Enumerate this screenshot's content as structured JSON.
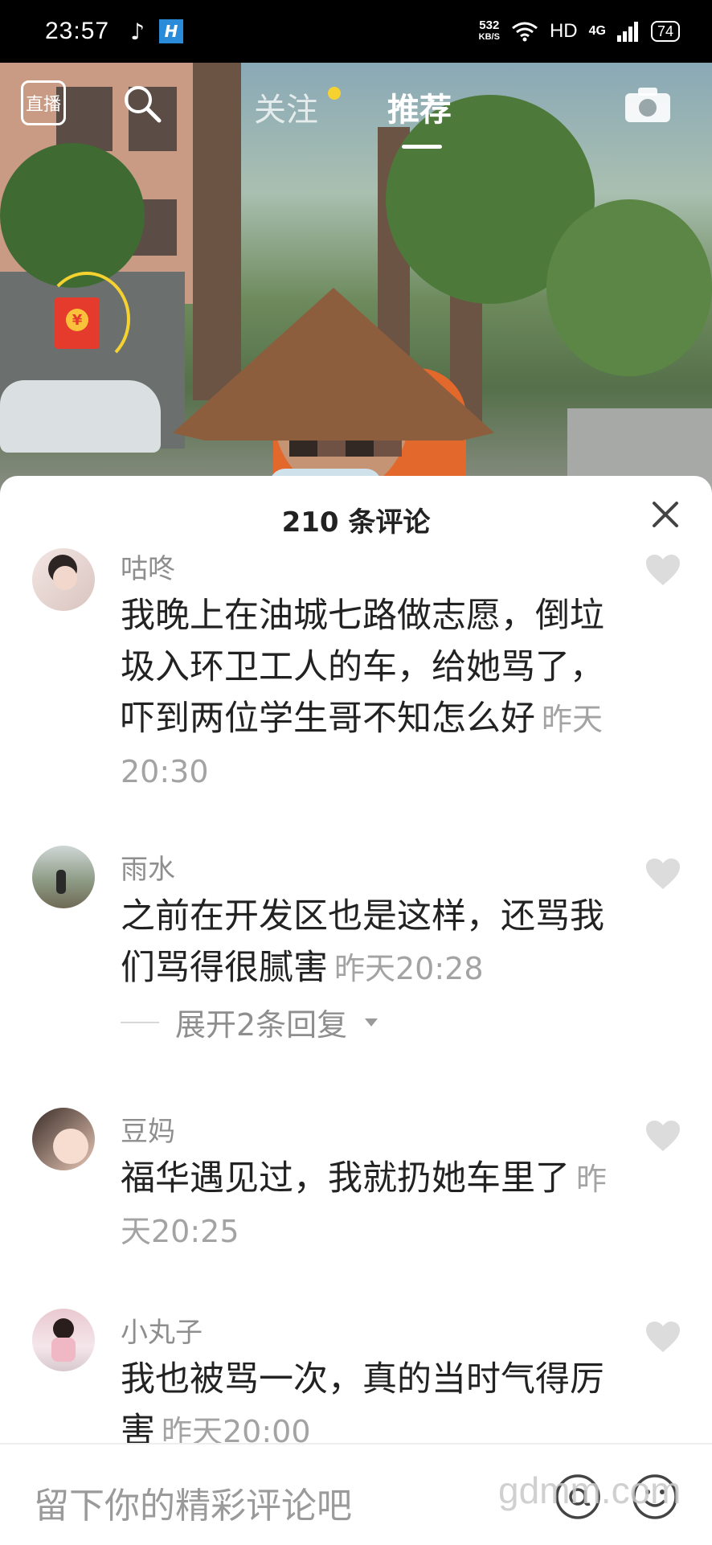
{
  "status_bar": {
    "time": "23:57",
    "app_icon_1": "tiktok-icon",
    "app_icon_2": "app-icon",
    "speed_value": "532",
    "speed_unit": "KB/S",
    "hd": "HD",
    "network": "4G",
    "battery": "74"
  },
  "top_nav": {
    "live_label": "直播",
    "tabs": [
      {
        "label": "关注",
        "active": false
      },
      {
        "label": "推荐",
        "active": true
      }
    ]
  },
  "comments_sheet": {
    "title": "210 条评论",
    "comments": [
      {
        "user": "咕咚",
        "text": "我晚上在油城七路做志愿，倒垃圾入环卫工人的车，给她骂了，吓到两位学生哥不知怎么好",
        "time": "昨天20:30"
      },
      {
        "user": "雨水",
        "text": "之前在开发区也是这样，还骂我们骂得很腻害",
        "time": "昨天20:28",
        "replies": "展开2条回复"
      },
      {
        "user": "豆妈",
        "text": "福华遇见过，我就扔她车里了",
        "time": "昨天20:25"
      },
      {
        "user": "小丸子",
        "text": "我也被骂一次，真的当时气得厉害",
        "time": "昨天20:00"
      }
    ]
  },
  "bottom_bar": {
    "placeholder": "留下你的精彩评论吧",
    "watermark": "gdmm.com"
  },
  "colors": {
    "accent_yellow": "#f6d231",
    "red_packet": "#e53b2c",
    "text_primary": "#222222",
    "text_secondary": "#8e8e8e"
  }
}
